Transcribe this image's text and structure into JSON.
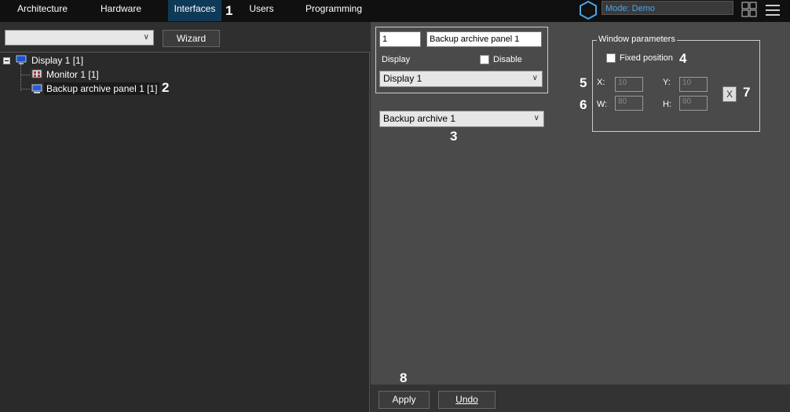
{
  "nav": {
    "tabs": [
      {
        "label": "Architecture"
      },
      {
        "label": "Hardware"
      },
      {
        "label": "Interfaces",
        "active": true
      },
      {
        "label": "Users"
      },
      {
        "label": "Programming"
      }
    ],
    "mode": "Mode: Demo"
  },
  "left": {
    "combo_value": "",
    "wizard_label": "Wizard",
    "tree": [
      {
        "label": "Display 1 [1]",
        "icon": "display-icon"
      },
      {
        "label": "Monitor 1 [1]",
        "icon": "monitor-icon"
      },
      {
        "label": "Backup archive panel 1 [1]",
        "icon": "panel-icon",
        "selected": true
      }
    ]
  },
  "props": {
    "id_value": "1",
    "name_value": "Backup archive panel 1",
    "display_label": "Display",
    "disable_label": "Disable",
    "display_select": "Display 1",
    "archive_select": "Backup archive 1"
  },
  "window_params": {
    "title": "Window parameters",
    "fixed_position_label": "Fixed position",
    "x_label": "X:",
    "y_label": "Y:",
    "w_label": "W:",
    "h_label": "H:",
    "x_value": "10",
    "y_value": "10",
    "w_value": "80",
    "h_value": "80",
    "reset_label": "X"
  },
  "footer": {
    "apply_label": "Apply",
    "undo_label": "Undo"
  },
  "callouts": [
    "1",
    "2",
    "3",
    "4",
    "5",
    "6",
    "7",
    "8"
  ],
  "colors": {
    "accent": "#4fa3e0",
    "active_tab": "#0e3a57"
  }
}
